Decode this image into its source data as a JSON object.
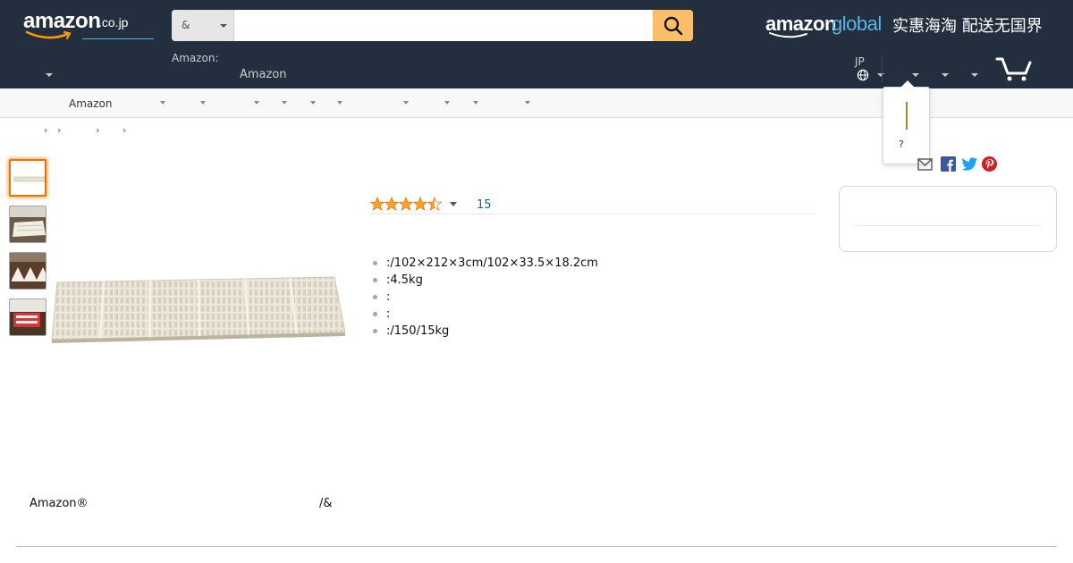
{
  "header": {
    "logo": {
      "word": "amazon",
      "tld": ".co.jp"
    },
    "search": {
      "department": "&",
      "placeholder": ""
    },
    "global_logo": {
      "part1": "amazon",
      "part2": "global",
      "slogan": "实惠海淘 配送无国界"
    },
    "deliver_label": "Amazon:",
    "deliver_value": "Amazon",
    "language": "JP"
  },
  "subnav": {
    "label": "Amazon"
  },
  "popover": {
    "text": "?"
  },
  "breadcrumb": [
    "›",
    "›",
    "›",
    "›"
  ],
  "product": {
    "rating": 4.5,
    "review_count": "15",
    "bullets": [
      ":/102×212×3cm/102×33.5×18.2cm",
      ":4.5kg",
      ":",
      ":",
      ":/150/15kg"
    ]
  },
  "brand": {
    "left": "Amazon®",
    "right": "/&"
  },
  "icons": {
    "search": "search-icon",
    "cart": "cart-icon",
    "globe": "globe-icon",
    "email": "email-share-icon",
    "facebook": "facebook-share-icon",
    "twitter": "twitter-share-icon",
    "pinterest": "pinterest-share-icon"
  },
  "colors": {
    "nav": "#232f3e",
    "search_button": "#febd69",
    "star": "#ffa41c",
    "link": "#007185",
    "thumbnail_selected": "#e77600"
  }
}
